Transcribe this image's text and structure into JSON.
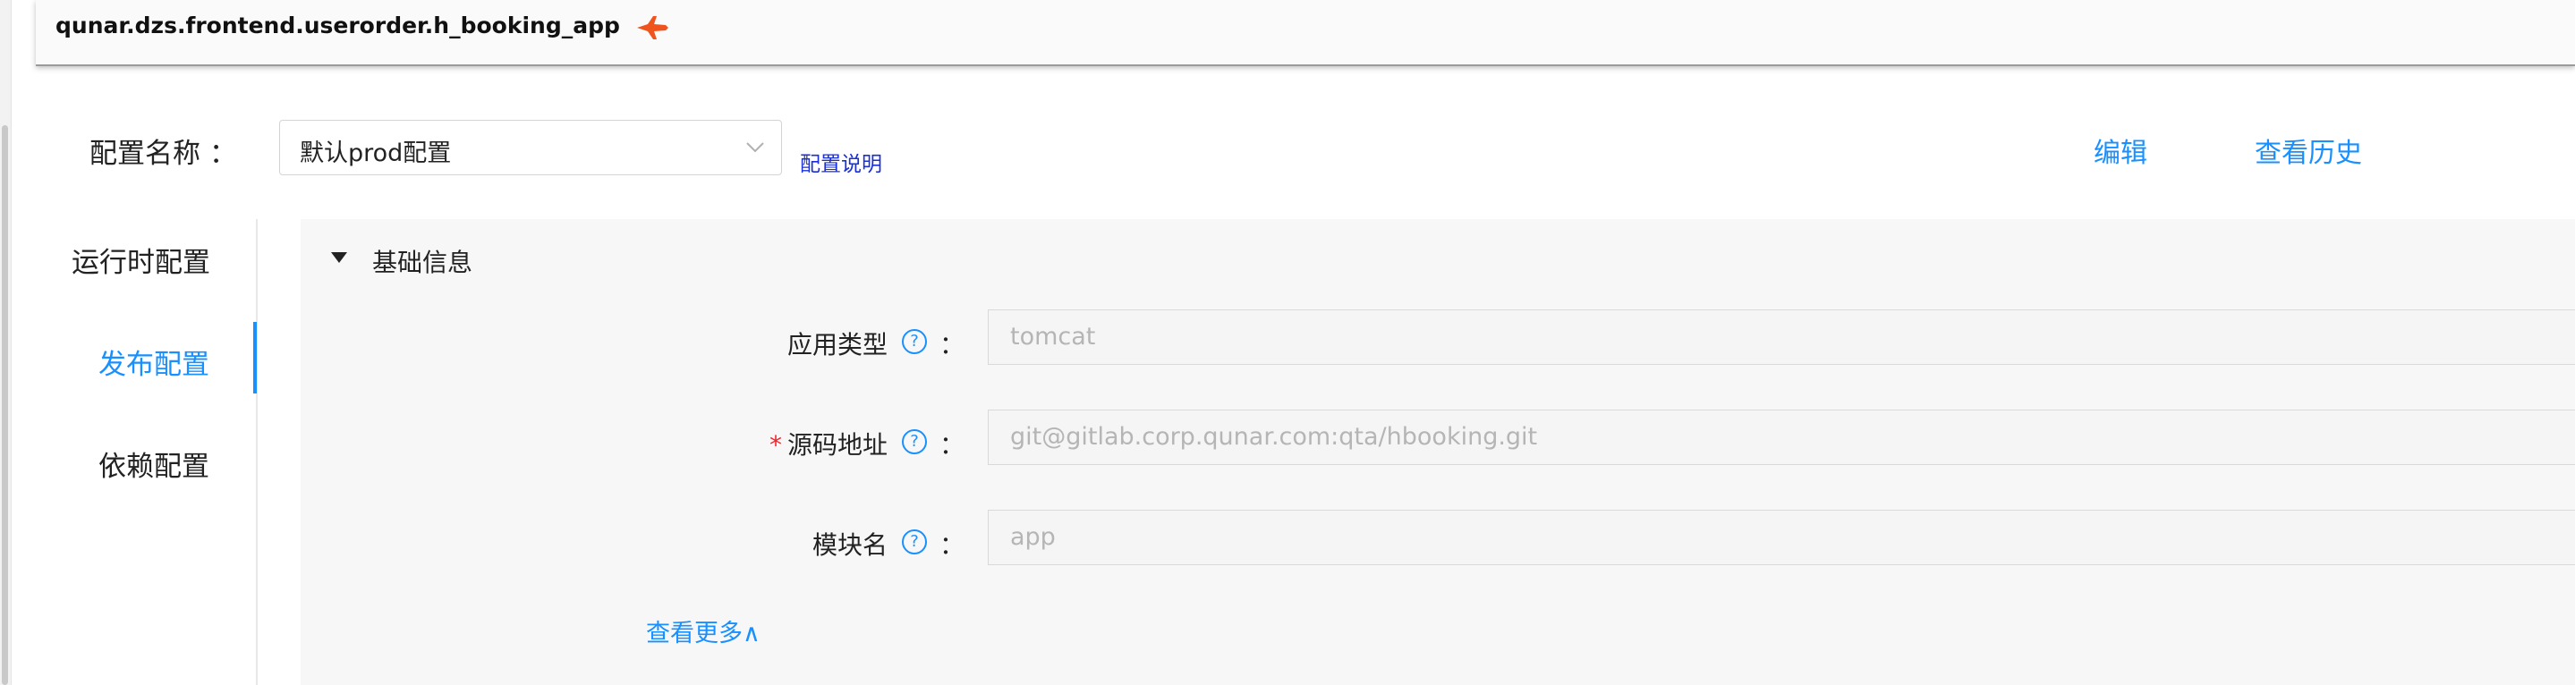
{
  "header": {
    "app_name": "qunar.dzs.frontend.userorder.h_booking_app"
  },
  "config": {
    "label": "配置名称 ：",
    "selected": "默认prod配置",
    "help_link": "配置说明",
    "edit": "编辑",
    "history": "查看历史"
  },
  "nav": {
    "items": [
      {
        "label": "运行时配置",
        "active": false
      },
      {
        "label": "发布配置",
        "active": true
      },
      {
        "label": "依赖配置",
        "active": false
      }
    ]
  },
  "section": {
    "title": "基础信息"
  },
  "form": {
    "fields": [
      {
        "label": "应用类型",
        "required": false,
        "placeholder": "tomcat"
      },
      {
        "label": "源码地址",
        "required": true,
        "placeholder": "git@gitlab.corp.qunar.com:qta/hbooking.git"
      },
      {
        "label": "模块名",
        "required": false,
        "placeholder": "app"
      }
    ],
    "help_glyph": "?",
    "colon": "：",
    "required_mark": "*",
    "more": "查看更多∧"
  },
  "colors": {
    "accent": "#1890ff",
    "required": "#f5222d",
    "link": "#1a2fd6"
  }
}
